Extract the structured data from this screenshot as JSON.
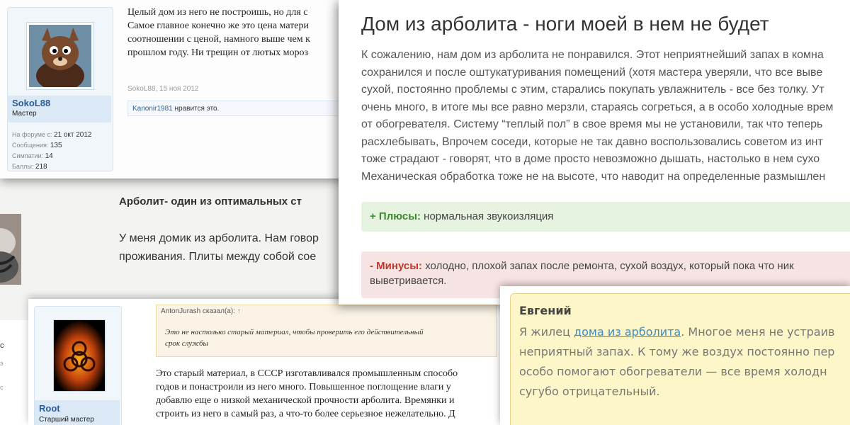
{
  "post1": {
    "username": "SokoL88",
    "role": "Мастер",
    "stats": [
      {
        "label": "На форуме с:",
        "value": "21 окт 2012"
      },
      {
        "label": "Сообщения:",
        "value": "135"
      },
      {
        "label": "Симпатии:",
        "value": "14"
      },
      {
        "label": "Баллы:",
        "value": "218"
      }
    ],
    "lines": [
      "Целый дом из него не построишь, но для с",
      "Самое главное конечно же это цена матери",
      "соотношении с ценой, намного выше чем к",
      "прошлом году. Ни трещин от лютых мороз"
    ],
    "meta": "SokoL88, 15 ноя 2012",
    "likes_user": "Kanonir1981",
    "likes_text": " нравится это."
  },
  "post2": {
    "heading": "Арболит- один из оптимальных ст",
    "lines": [
      "У меня домик из арболита. Нам говор",
      "проживания. Плиты между собой сое"
    ],
    "side_fragments": [
      "с",
      "э",
      "с"
    ]
  },
  "post3": {
    "username": "Root",
    "role": "Старший мастер",
    "quote_author": "AntonJurash сказал(а):",
    "quote_arrow": "↑",
    "quote_lines": [
      "Это не настолько старый материал, чтобы проверить его действительный",
      "срок службы"
    ],
    "lines": [
      "Это старый материал, в СССР изготавливался промышленным способо",
      "годов и понастроили из него много. Повышенное поглощение влаги у",
      "добавлю еще о низкой механической прочности арболита. Времянки и",
      "строить из него в самый раз, а что-то более серьезное нежелательно. Д"
    ]
  },
  "review": {
    "title": "Дом из арболита - ноги моей в нем не будет",
    "lines": [
      "К сожалению, нам дом из арболита не понравился. Этот неприятнейший запах в комна",
      "сохранился и после оштукатуривания помещений (хотя мастера уверяли, что все выве",
      "сухой, постоянно проблемы с этим, старались покупать увлажнитель - все без толку. Ут",
      "очень много, в итоге мы все равно мерзли, стараясь согреться, а в особо холодные врем",
      "от обогревателя. Систему “теплый пол” в свое время мы не установили, так что теперь",
      "расхлебывать, Впрочем соседи, которые не так давно воспользовались советом из инт",
      "тоже страдают - говорят, что в доме просто невозможно дышать, настолько в нем сухо",
      "Механическая обработка тоже не на высоте, что наводит на определенные размышлен"
    ],
    "plus_label": "+ Плюсы:",
    "plus_text": " нормальная звукоизляция",
    "minus_label": "- Минусы:",
    "minus_text": " холодно, плохой запах после ремонта, сухой воздух, который пока что ник",
    "minus_text2": "выветривается."
  },
  "comment": {
    "name": "Евгений",
    "line1_prefix": "Я жилец ",
    "line1_link": "дома из арболита",
    "line1_suffix": ". Многое меня не устраив",
    "lines": [
      "неприятный запах. К тому же воздух постоянно пер",
      "особо помогают обогреватели — все время холодн",
      "сугубо отрицательный."
    ]
  },
  "colors": {
    "link": "#2a5d98",
    "plus": "#3c8a2e",
    "minus": "#c0392b",
    "comment_bg": "#fdf6c8"
  }
}
